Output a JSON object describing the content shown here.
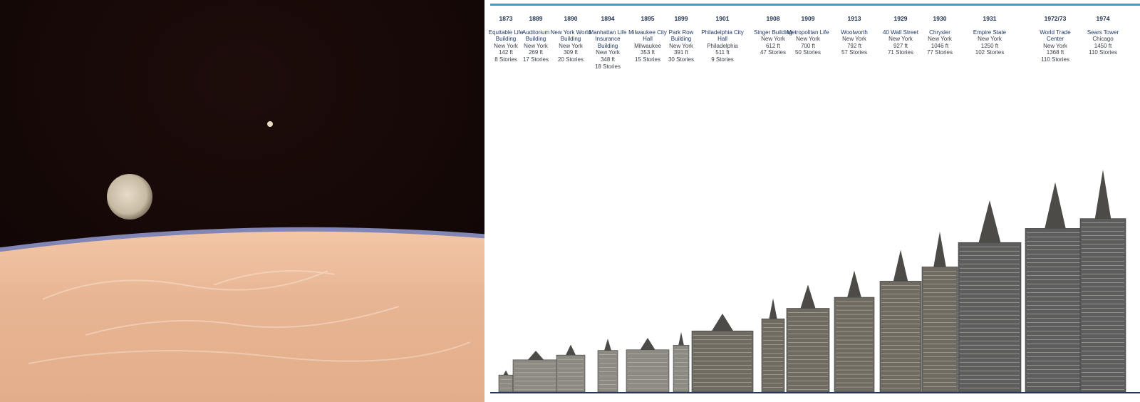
{
  "colors": {
    "accent": "#27a3e0",
    "text": "#1f3864",
    "space": "#1a0a08",
    "planet": "#e7b795"
  },
  "left_image": {
    "description_icon": "planet-horizon-with-moons-image"
  },
  "buildings": [
    {
      "year": "1873",
      "name": "Equitable Life Building",
      "city": "New York",
      "height": "142 ft",
      "stories": "8 Stories",
      "ft": 142
    },
    {
      "year": "1889",
      "name": "Auditorium Building",
      "city": "New York",
      "height": "269 ft",
      "stories": "17 Stories",
      "ft": 269
    },
    {
      "year": "1890",
      "name": "New York World Building",
      "city": "New York",
      "height": "309 ft",
      "stories": "20 Stories",
      "ft": 309
    },
    {
      "year": "1894",
      "name": "Manhattan Life Insurance Building",
      "city": "New York",
      "height": "348 ft",
      "stories": "18 Stories",
      "ft": 348
    },
    {
      "year": "1895",
      "name": "Milwaukee City Hall",
      "city": "Milwaukee",
      "height": "353 ft",
      "stories": "15 Stories",
      "ft": 353
    },
    {
      "year": "1899",
      "name": "Park Row Building",
      "city": "New York",
      "height": "391 ft",
      "stories": "30 Stories",
      "ft": 391
    },
    {
      "year": "1901",
      "name": "Philadelphia City Hall",
      "city": "Philadelphia",
      "height": "511 ft",
      "stories": "9 Stories",
      "ft": 511
    },
    {
      "year": "1908",
      "name": "Singer Building",
      "city": "New York",
      "height": "612 ft",
      "stories": "47 Stories",
      "ft": 612
    },
    {
      "year": "1909",
      "name": "Metropolitan Life",
      "city": "New York",
      "height": "700 ft",
      "stories": "50 Stories",
      "ft": 700
    },
    {
      "year": "1913",
      "name": "Woolworth",
      "city": "New York",
      "height": "792 ft",
      "stories": "57 Stories",
      "ft": 792
    },
    {
      "year": "1929",
      "name": "40 Wall Street",
      "city": "New York",
      "height": "927 ft",
      "stories": "71 Stories",
      "ft": 927
    },
    {
      "year": "1930",
      "name": "Chrysler",
      "city": "New York",
      "height": "1046 ft",
      "stories": "77 Stories",
      "ft": 1046
    },
    {
      "year": "1931",
      "name": "Empire State",
      "city": "New York",
      "height": "1250 ft",
      "stories": "102 Stories",
      "ft": 1250
    },
    {
      "year": "1972/73",
      "name": "World Trade Center",
      "city": "New York",
      "height": "1368 ft",
      "stories": "110 Stories",
      "ft": 1368
    },
    {
      "year": "1974",
      "name": "Sears Tower",
      "city": "Chicago",
      "height": "1450 ft",
      "stories": "110 Stories",
      "ft": 1450
    }
  ]
}
